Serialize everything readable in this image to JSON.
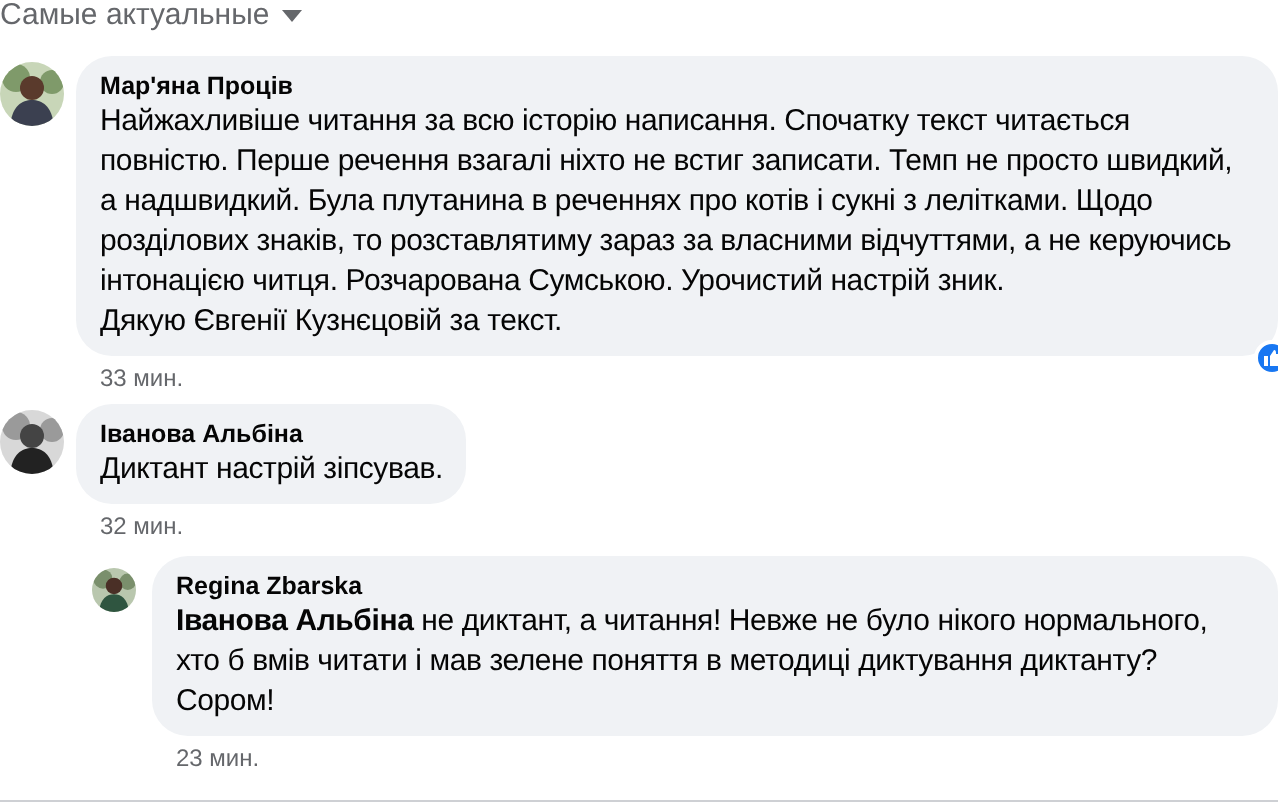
{
  "sort_menu": {
    "label": "Самые актуальные"
  },
  "comments": [
    {
      "author": "Мар'яна Проців",
      "text": "Найжахливіше читання за всю історію написання. Спочатку текст читається повністю. Перше речення взагалі ніхто не встиг записати. Темп не просто швидкий, а надшвидкий. Була плутанина в реченнях про котів і сукні з лелітками. Щодо розділових знаків, то розставлятиму зараз за власними відчуттями, а не керуючись інтонацією читця. Розчарована Сумською. Урочистий настрій зник.\nДякую Євгенії Кузнєцовій за текст.",
      "time": "33 мин.",
      "liked": true,
      "reply": false
    },
    {
      "author": "Іванова Альбіна",
      "text": "Диктант настрій зіпсував.",
      "time": "32 мин.",
      "liked": false,
      "reply": false
    },
    {
      "author": "Regina Zbarska",
      "text": "**Іванова Альбіна** не диктант, а читання! Невже не було нікого нормального, хто б вмів читати і мав зелене поняття в методиці диктування диктанту? Сором!",
      "time": "23 мин.",
      "liked": false,
      "reply": true
    }
  ]
}
